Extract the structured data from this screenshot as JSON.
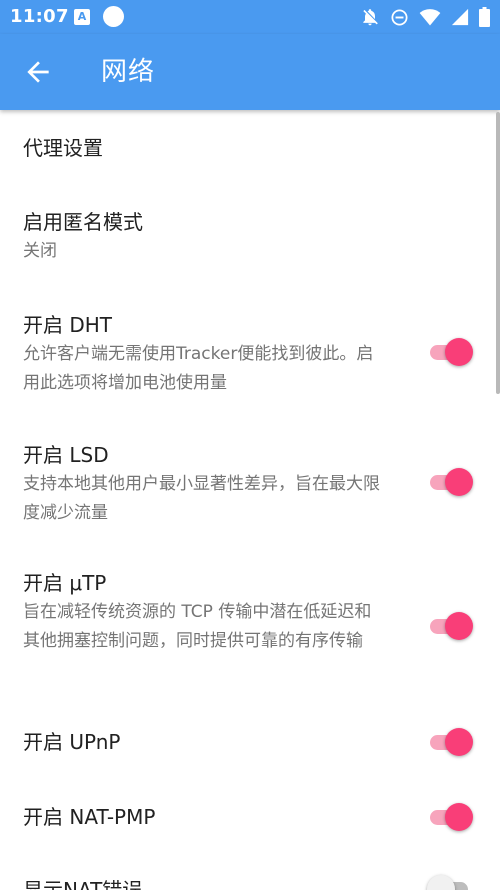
{
  "status_bar": {
    "time": "11:07",
    "notif_letter": "A"
  },
  "app_bar": {
    "title": "网络"
  },
  "prefs": {
    "proxy": {
      "title": "代理设置"
    },
    "anonymous": {
      "title": "启用匿名模式",
      "summary": "关闭"
    },
    "dht": {
      "title": "开启 DHT",
      "summary": "允许客户端无需使用Tracker便能找到彼此。启用此选项将增加电池使用量",
      "enabled": true
    },
    "lsd": {
      "title": "开启 LSD",
      "summary": "支持本地其他用户最小显著性差异，旨在最大限度减少流量",
      "enabled": true
    },
    "utp": {
      "title": "开启 μTP",
      "summary": "旨在减轻传统资源的 TCP 传输中潜在低延迟和其他拥塞控制问题，同时提供可靠的有序传输",
      "enabled": true
    },
    "upnp": {
      "title": "开启 UPnP",
      "enabled": true
    },
    "natpmp": {
      "title": "开启 NAT-PMP",
      "enabled": true
    },
    "nat_errors": {
      "title": "显示NAT错误",
      "enabled": false
    }
  },
  "colors": {
    "primary": "#4a9af0",
    "accent": "#f93e78",
    "accent_track": "#f7a4bc"
  },
  "icons": {
    "back": "arrow-left-icon",
    "dnd": "do-not-disturb-icon",
    "mute": "notifications-off-icon",
    "wifi": "wifi-icon",
    "signal": "cell-signal-icon",
    "battery": "battery-icon"
  }
}
